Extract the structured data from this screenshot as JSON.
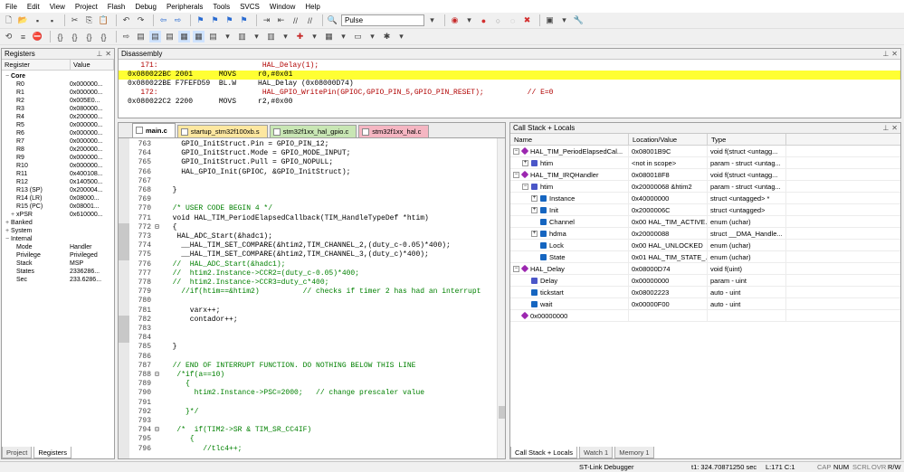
{
  "menu": [
    "File",
    "Edit",
    "View",
    "Project",
    "Flash",
    "Debug",
    "Peripherals",
    "Tools",
    "SVCS",
    "Window",
    "Help"
  ],
  "toolbar": {
    "target_name": "Pulse"
  },
  "registers": {
    "title": "Registers",
    "col_register": "Register",
    "col_value": "Value",
    "rows": [
      {
        "n": "Core",
        "v": "",
        "indent": 1,
        "bold": true,
        "exp": "−"
      },
      {
        "n": "R0",
        "v": "0x000000...",
        "indent": 3
      },
      {
        "n": "R1",
        "v": "0x000000...",
        "indent": 3
      },
      {
        "n": "R2",
        "v": "0x005E0...",
        "indent": 3
      },
      {
        "n": "R3",
        "v": "0x080000...",
        "indent": 3
      },
      {
        "n": "R4",
        "v": "0x200000...",
        "indent": 3
      },
      {
        "n": "R5",
        "v": "0x000000...",
        "indent": 3
      },
      {
        "n": "R6",
        "v": "0x000000...",
        "indent": 3
      },
      {
        "n": "R7",
        "v": "0x000000...",
        "indent": 3
      },
      {
        "n": "R8",
        "v": "0x200000...",
        "indent": 3
      },
      {
        "n": "R9",
        "v": "0x000000...",
        "indent": 3
      },
      {
        "n": "R10",
        "v": "0x000000...",
        "indent": 3
      },
      {
        "n": "R11",
        "v": "0x400108...",
        "indent": 3
      },
      {
        "n": "R12",
        "v": "0x140500...",
        "indent": 3
      },
      {
        "n": "R13 (SP)",
        "v": "0x200004...",
        "indent": 3
      },
      {
        "n": "R14 (LR)",
        "v": "0x08000...",
        "indent": 3
      },
      {
        "n": "R15 (PC)",
        "v": "0x08001...",
        "indent": 3
      },
      {
        "n": "xPSR",
        "v": "0x610000...",
        "indent": 2,
        "exp": "+"
      },
      {
        "n": "Banked",
        "v": "",
        "indent": 1,
        "exp": "+"
      },
      {
        "n": "System",
        "v": "",
        "indent": 1,
        "exp": "+"
      },
      {
        "n": "Internal",
        "v": "",
        "indent": 1,
        "exp": "−"
      },
      {
        "n": "Mode",
        "v": "Handler",
        "indent": 3
      },
      {
        "n": "Privilege",
        "v": "Privileged",
        "indent": 3
      },
      {
        "n": "Stack",
        "v": "MSP",
        "indent": 3
      },
      {
        "n": "States",
        "v": "2336286...",
        "indent": 3
      },
      {
        "n": "Sec",
        "v": "233.6286...",
        "indent": 3
      }
    ],
    "tab_project": "Project",
    "tab_registers": "Registers"
  },
  "disassembly": {
    "title": "Disassembly",
    "lines": [
      {
        "t": "   171:                        HAL_Delay(1);",
        "k": "src"
      },
      {
        "t": "0x080022BC 2001      MOVS     r0,#0x01",
        "k": "hl"
      },
      {
        "t": "0x080022BE F7FEFD59  BL.W     HAL_Delay (0x08000D74)",
        "k": "asm"
      },
      {
        "t": "   172:                        HAL_GPIO_WritePin(GPIOC,GPIO_PIN_5,GPIO_PIN_RESET);          // E=0",
        "k": "src"
      },
      {
        "t": "0x080022C2 2200      MOVS     r2,#0x00",
        "k": "asm"
      }
    ]
  },
  "editor": {
    "tabs": [
      {
        "label": "main.c",
        "color": "#ffffff",
        "active": true
      },
      {
        "label": "startup_stm32f100xb.s",
        "color": "#fde7a0"
      },
      {
        "label": "stm32f1xx_hal_gpio.c",
        "color": "#c8e6b4"
      },
      {
        "label": "stm32f1xx_hal.c",
        "color": "#f5b6c2"
      }
    ],
    "lines": [
      {
        "n": "763",
        "t": "    GPIO_InitStruct.Pin = GPIO_PIN_12;"
      },
      {
        "n": "764",
        "t": "    GPIO_InitStruct.Mode = GPIO_MODE_INPUT;"
      },
      {
        "n": "765",
        "t": "    GPIO_InitStruct.Pull = GPIO_NOPULL;"
      },
      {
        "n": "766",
        "t": "    HAL_GPIO_Init(GPIOC, &GPIO_InitStruct);"
      },
      {
        "n": "767",
        "t": ""
      },
      {
        "n": "768",
        "t": "  }"
      },
      {
        "n": "769",
        "t": ""
      },
      {
        "n": "770",
        "t": "  /* USER CODE BEGIN 4 */",
        "c": "cmt"
      },
      {
        "n": "771",
        "t": "  void HAL_TIM_PeriodElapsedCallback(TIM_HandleTypeDef *htim)"
      },
      {
        "n": "772",
        "t": "  {",
        "f": "⊟"
      },
      {
        "n": "773",
        "t": "   HAL_ADC_Start(&hadc1);"
      },
      {
        "n": "774",
        "t": "    __HAL_TIM_SET_COMPARE(&htim2,TIM_CHANNEL_2,(duty_c-0.05)*400);"
      },
      {
        "n": "775",
        "t": "    __HAL_TIM_SET_COMPARE(&htim2,TIM_CHANNEL_3,(duty_c)*400);"
      },
      {
        "n": "776",
        "t": "  //  HAL_ADC_Start(&hadc1);",
        "c": "cmt"
      },
      {
        "n": "777",
        "t": "  //  htim2.Instance->CCR2=(duty_c-0.05)*400;",
        "c": "cmt"
      },
      {
        "n": "778",
        "t": "  //  htim2.Instance->CCR3=duty_c*400;",
        "c": "cmt"
      },
      {
        "n": "779",
        "t": "    //if(htim==&htim2)          // checks if timer 2 has had an interrupt",
        "c": "cmt"
      },
      {
        "n": "780",
        "t": ""
      },
      {
        "n": "781",
        "t": "      varx++;"
      },
      {
        "n": "782",
        "t": "      contador++;"
      },
      {
        "n": "783",
        "t": ""
      },
      {
        "n": "784",
        "t": ""
      },
      {
        "n": "785",
        "t": "  }"
      },
      {
        "n": "786",
        "t": ""
      },
      {
        "n": "787",
        "t": "  // END OF INTERRUPT FUNCTION. DO NOTHING BELOW THIS LINE",
        "c": "cmt"
      },
      {
        "n": "788",
        "t": "   /*if(a==10)",
        "c": "cmt",
        "f": "⊟"
      },
      {
        "n": "789",
        "t": "     {",
        "c": "cmt"
      },
      {
        "n": "790",
        "t": "       htim2.Instance->PSC=2000;   // change prescaler value",
        "c": "cmt"
      },
      {
        "n": "791",
        "t": "",
        "c": "cmt"
      },
      {
        "n": "792",
        "t": "     }*/",
        "c": "cmt"
      },
      {
        "n": "793",
        "t": ""
      },
      {
        "n": "794",
        "t": "   /*  if(TIM2->SR & TIM_SR_CC4IF)",
        "c": "cmt",
        "f": "⊟"
      },
      {
        "n": "795",
        "t": "      {",
        "c": "cmt"
      },
      {
        "n": "796",
        "t": "         //tlc4++;",
        "c": "cmt"
      }
    ]
  },
  "callstack": {
    "title": "Call Stack + Locals",
    "col_name": "Name",
    "col_value": "Location/Value",
    "col_type": "Type",
    "rows": [
      {
        "name": "HAL_TIM_PeriodElapsedCal...",
        "val": "0x08001B9C",
        "typ": "void f(struct <untagg...",
        "lvl": 0,
        "exp": "−",
        "icon": "fn"
      },
      {
        "name": "htim",
        "val": "<not in scope>",
        "typ": "param - struct <untag...",
        "lvl": 1,
        "exp": "+",
        "icon": "par"
      },
      {
        "name": "HAL_TIM_IRQHandler",
        "val": "0x080018F8",
        "typ": "void f(struct <untagg...",
        "lvl": 0,
        "exp": "−",
        "icon": "fn"
      },
      {
        "name": "htim",
        "val": "0x20000068 &htim2",
        "typ": "param - struct <untag...",
        "lvl": 1,
        "exp": "−",
        "icon": "par"
      },
      {
        "name": "Instance",
        "val": "0x40000000",
        "typ": "struct <untagged> *",
        "lvl": 2,
        "exp": "+",
        "icon": "var"
      },
      {
        "name": "Init",
        "val": "0x2000006C",
        "typ": "struct <untagged>",
        "lvl": 2,
        "exp": "+",
        "icon": "var"
      },
      {
        "name": "Channel",
        "val": "0x00 HAL_TIM_ACTIVE...",
        "typ": "enum (uchar)",
        "lvl": 2,
        "exp": "",
        "icon": "var"
      },
      {
        "name": "hdma",
        "val": "0x20000088",
        "typ": "struct __DMA_Handle...",
        "lvl": 2,
        "exp": "+",
        "icon": "var"
      },
      {
        "name": "Lock",
        "val": "0x00 HAL_UNLOCKED",
        "typ": "enum (uchar)",
        "lvl": 2,
        "exp": "",
        "icon": "var"
      },
      {
        "name": "State",
        "val": "0x01 HAL_TIM_STATE_...",
        "typ": "enum (uchar)",
        "lvl": 2,
        "exp": "",
        "icon": "var"
      },
      {
        "name": "HAL_Delay",
        "val": "0x08000D74",
        "typ": "void f(uint)",
        "lvl": 0,
        "exp": "−",
        "icon": "fn"
      },
      {
        "name": "Delay",
        "val": "0x00000000",
        "typ": "param - uint",
        "lvl": 1,
        "exp": "",
        "icon": "par"
      },
      {
        "name": "tickstart",
        "val": "0x08002223",
        "typ": "auto - uint",
        "lvl": 1,
        "exp": "",
        "icon": "var"
      },
      {
        "name": "wait",
        "val": "0x00000F00",
        "typ": "auto - uint",
        "lvl": 1,
        "exp": "",
        "icon": "var"
      },
      {
        "name": "0x00000000",
        "val": "",
        "typ": "",
        "lvl": 0,
        "exp": "",
        "icon": "fn"
      }
    ],
    "tabs": [
      {
        "label": "Call Stack + Locals",
        "active": true
      },
      {
        "label": "Watch 1"
      },
      {
        "label": "Memory 1"
      }
    ]
  },
  "status": {
    "debugger": "ST-Link Debugger",
    "time": "t1: 324.70871250 sec",
    "pos": "L:171 C:1",
    "cap": "CAP",
    "num": "NUM",
    "scrl": "SCRL",
    "ovr": "OVR",
    "rw": "R/W"
  }
}
